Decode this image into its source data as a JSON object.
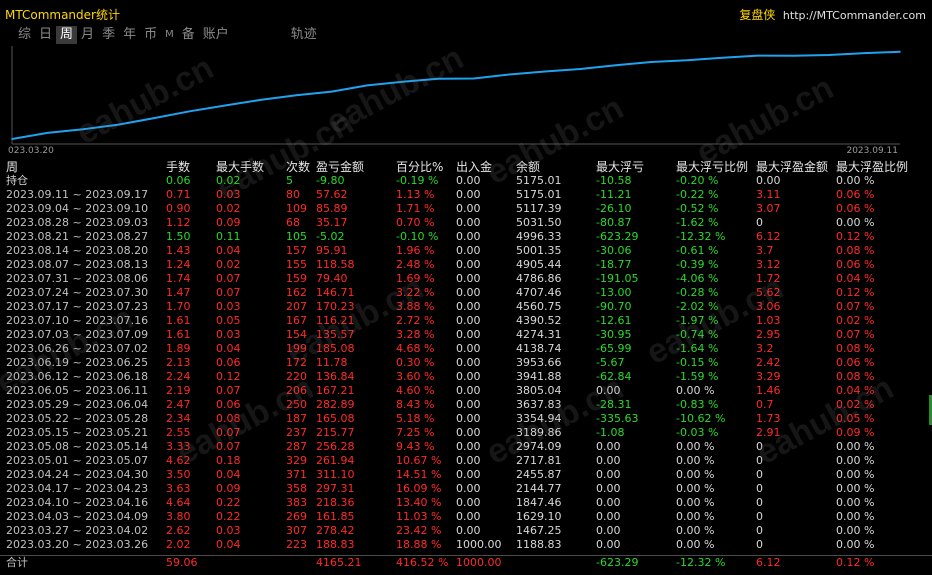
{
  "window": {
    "title": "MTCommander统计",
    "brand_name": "复盘侠",
    "brand_url": "http://MTCommander.com"
  },
  "tabs": [
    {
      "label": "综",
      "active": false
    },
    {
      "label": "日",
      "active": false
    },
    {
      "label": "周",
      "active": true
    },
    {
      "label": "月",
      "active": false
    },
    {
      "label": "季",
      "active": false
    },
    {
      "label": "年",
      "active": false
    },
    {
      "label": "币",
      "active": false
    },
    {
      "label": "M",
      "active": false
    },
    {
      "label": "备",
      "active": false
    },
    {
      "label": "账户",
      "active": false
    },
    {
      "label": "轨迹",
      "active": false
    }
  ],
  "chart_data": {
    "type": "line",
    "x_start_label": "023.03.20",
    "x_end_label": "2023.09.11",
    "series": [
      {
        "color": "#1fa3f0",
        "values": [
          1188.83,
          1467.25,
          1629.1,
          1847.46,
          2144.77,
          2455.87,
          2717.81,
          2974.09,
          3189.86,
          3354.94,
          3637.83,
          3805.04,
          3941.88,
          3953.66,
          4138.74,
          4274.31,
          4390.52,
          4560.75,
          4707.46,
          4786.86,
          4905.44,
          5001.35,
          4996.33,
          5031.5,
          5117.39,
          5175.01
        ]
      }
    ]
  },
  "table": {
    "headers": [
      "周",
      "手数",
      "最大手数",
      "次数",
      "盈亏金额",
      "百分比%",
      "出入金",
      "余额",
      "最大浮亏",
      "最大浮亏比例",
      "最大浮盈金额",
      "最大浮盈比例"
    ],
    "holding": {
      "label": "持仓",
      "lots": "0.06",
      "max_lots": "0.02",
      "count": "5",
      "pnl": "-9.80",
      "pct": "-0.19 %",
      "io": "0.00",
      "balance": "5175.01",
      "max_loss": "-10.58",
      "max_loss_pct": "-0.20 %",
      "max_gain": "0.00",
      "max_gain_pct": "0.00 %"
    },
    "rows": [
      {
        "week": "2023.09.11 ~ 2023.09.17",
        "lots": "0.71",
        "max_lots": "0.03",
        "count": "80",
        "pnl": "57.62",
        "pct": "1.13 %",
        "io": "0.00",
        "balance": "5175.01",
        "max_loss": "-11.21",
        "max_loss_pct": "-0.22 %",
        "max_gain": "3.11",
        "max_gain_pct": "0.06 %",
        "tone": "red"
      },
      {
        "week": "2023.09.04 ~ 2023.09.10",
        "lots": "0.90",
        "max_lots": "0.02",
        "count": "109",
        "pnl": "85.89",
        "pct": "1.71 %",
        "io": "0.00",
        "balance": "5117.39",
        "max_loss": "-26.10",
        "max_loss_pct": "-0.52 %",
        "max_gain": "3.07",
        "max_gain_pct": "0.06 %",
        "tone": "red"
      },
      {
        "week": "2023.08.28 ~ 2023.09.03",
        "lots": "1.12",
        "max_lots": "0.09",
        "count": "68",
        "pnl": "35.17",
        "pct": "0.70 %",
        "io": "0.00",
        "balance": "5031.50",
        "max_loss": "-80.87",
        "max_loss_pct": "-1.62 %",
        "max_gain": "0",
        "max_gain_pct": "0.00 %",
        "tone": "red"
      },
      {
        "week": "2023.08.21 ~ 2023.08.27",
        "lots": "1.50",
        "max_lots": "0.11",
        "count": "105",
        "pnl": "-5.02",
        "pct": "-0.10 %",
        "io": "0.00",
        "balance": "4996.33",
        "max_loss": "-623.29",
        "max_loss_pct": "-12.32 %",
        "max_gain": "6.12",
        "max_gain_pct": "0.12 %",
        "tone": "grn"
      },
      {
        "week": "2023.08.14 ~ 2023.08.20",
        "lots": "1.43",
        "max_lots": "0.04",
        "count": "157",
        "pnl": "95.91",
        "pct": "1.96 %",
        "io": "0.00",
        "balance": "5001.35",
        "max_loss": "-30.06",
        "max_loss_pct": "-0.61 %",
        "max_gain": "3.7",
        "max_gain_pct": "0.08 %",
        "tone": "red"
      },
      {
        "week": "2023.08.07 ~ 2023.08.13",
        "lots": "1.24",
        "max_lots": "0.02",
        "count": "155",
        "pnl": "118.58",
        "pct": "2.48 %",
        "io": "0.00",
        "balance": "4905.44",
        "max_loss": "-18.77",
        "max_loss_pct": "-0.39 %",
        "max_gain": "3.12",
        "max_gain_pct": "0.06 %",
        "tone": "red"
      },
      {
        "week": "2023.07.31 ~ 2023.08.06",
        "lots": "1.74",
        "max_lots": "0.07",
        "count": "159",
        "pnl": "79.40",
        "pct": "1.69 %",
        "io": "0.00",
        "balance": "4786.86",
        "max_loss": "-191.05",
        "max_loss_pct": "-4.06 %",
        "max_gain": "1.72",
        "max_gain_pct": "0.04 %",
        "tone": "red"
      },
      {
        "week": "2023.07.24 ~ 2023.07.30",
        "lots": "1.47",
        "max_lots": "0.07",
        "count": "162",
        "pnl": "146.71",
        "pct": "3.22 %",
        "io": "0.00",
        "balance": "4707.46",
        "max_loss": "-13.00",
        "max_loss_pct": "-0.28 %",
        "max_gain": "5.62",
        "max_gain_pct": "0.12 %",
        "tone": "red"
      },
      {
        "week": "2023.07.17 ~ 2023.07.23",
        "lots": "1.70",
        "max_lots": "0.03",
        "count": "207",
        "pnl": "170.23",
        "pct": "3.88 %",
        "io": "0.00",
        "balance": "4560.75",
        "max_loss": "-90.70",
        "max_loss_pct": "-2.02 %",
        "max_gain": "3.06",
        "max_gain_pct": "0.07 %",
        "tone": "red"
      },
      {
        "week": "2023.07.10 ~ 2023.07.16",
        "lots": "1.61",
        "max_lots": "0.05",
        "count": "167",
        "pnl": "116.21",
        "pct": "2.72 %",
        "io": "0.00",
        "balance": "4390.52",
        "max_loss": "-12.61",
        "max_loss_pct": "-1.97 %",
        "max_gain": "1.03",
        "max_gain_pct": "0.02 %",
        "tone": "red"
      },
      {
        "week": "2023.07.03 ~ 2023.07.09",
        "lots": "1.61",
        "max_lots": "0.03",
        "count": "154",
        "pnl": "135.57",
        "pct": "3.28 %",
        "io": "0.00",
        "balance": "4274.31",
        "max_loss": "-30.95",
        "max_loss_pct": "-0.74 %",
        "max_gain": "2.95",
        "max_gain_pct": "0.07 %",
        "tone": "red"
      },
      {
        "week": "2023.06.26 ~ 2023.07.02",
        "lots": "1.89",
        "max_lots": "0.04",
        "count": "199",
        "pnl": "185.08",
        "pct": "4.68 %",
        "io": "0.00",
        "balance": "4138.74",
        "max_loss": "-65.99",
        "max_loss_pct": "-1.64 %",
        "max_gain": "3.2",
        "max_gain_pct": "0.08 %",
        "tone": "red"
      },
      {
        "week": "2023.06.19 ~ 2023.06.25",
        "lots": "2.13",
        "max_lots": "0.06",
        "count": "172",
        "pnl": "11.78",
        "pct": "0.30 %",
        "io": "0.00",
        "balance": "3953.66",
        "max_loss": "-5.67",
        "max_loss_pct": "-0.15 %",
        "max_gain": "2.42",
        "max_gain_pct": "0.06 %",
        "tone": "red"
      },
      {
        "week": "2023.06.12 ~ 2023.06.18",
        "lots": "2.24",
        "max_lots": "0.12",
        "count": "220",
        "pnl": "136.84",
        "pct": "3.60 %",
        "io": "0.00",
        "balance": "3941.88",
        "max_loss": "-62.84",
        "max_loss_pct": "-1.59 %",
        "max_gain": "3.29",
        "max_gain_pct": "0.08 %",
        "tone": "red"
      },
      {
        "week": "2023.06.05 ~ 2023.06.11",
        "lots": "2.19",
        "max_lots": "0.07",
        "count": "206",
        "pnl": "167.21",
        "pct": "4.60 %",
        "io": "0.00",
        "balance": "3805.04",
        "max_loss": "0.00",
        "max_loss_pct": "0.00 %",
        "max_gain": "1.46",
        "max_gain_pct": "0.04 %",
        "tone": "red"
      },
      {
        "week": "2023.05.29 ~ 2023.06.04",
        "lots": "2.47",
        "max_lots": "0.06",
        "count": "250",
        "pnl": "282.89",
        "pct": "8.43 %",
        "io": "0.00",
        "balance": "3637.83",
        "max_loss": "-28.31",
        "max_loss_pct": "-0.83 %",
        "max_gain": "0.7",
        "max_gain_pct": "0.02 %",
        "tone": "red"
      },
      {
        "week": "2023.05.22 ~ 2023.05.28",
        "lots": "2.34",
        "max_lots": "0.08",
        "count": "187",
        "pnl": "165.08",
        "pct": "5.18 %",
        "io": "0.00",
        "balance": "3354.94",
        "max_loss": "-335.63",
        "max_loss_pct": "-10.62 %",
        "max_gain": "1.73",
        "max_gain_pct": "0.05 %",
        "tone": "red"
      },
      {
        "week": "2023.05.15 ~ 2023.05.21",
        "lots": "2.55",
        "max_lots": "0.07",
        "count": "237",
        "pnl": "215.77",
        "pct": "7.25 %",
        "io": "0.00",
        "balance": "3189.86",
        "max_loss": "-1.08",
        "max_loss_pct": "-0.03 %",
        "max_gain": "2.91",
        "max_gain_pct": "0.09 %",
        "tone": "red"
      },
      {
        "week": "2023.05.08 ~ 2023.05.14",
        "lots": "3.33",
        "max_lots": "0.07",
        "count": "287",
        "pnl": "256.28",
        "pct": "9.43 %",
        "io": "0.00",
        "balance": "2974.09",
        "max_loss": "0.00",
        "max_loss_pct": "0.00 %",
        "max_gain": "0",
        "max_gain_pct": "0.00 %",
        "tone": "red"
      },
      {
        "week": "2023.05.01 ~ 2023.05.07",
        "lots": "4.62",
        "max_lots": "0.18",
        "count": "329",
        "pnl": "261.94",
        "pct": "10.67 %",
        "io": "0.00",
        "balance": "2717.81",
        "max_loss": "0.00",
        "max_loss_pct": "0.00 %",
        "max_gain": "0",
        "max_gain_pct": "0.00 %",
        "tone": "red"
      },
      {
        "week": "2023.04.24 ~ 2023.04.30",
        "lots": "3.50",
        "max_lots": "0.04",
        "count": "371",
        "pnl": "311.10",
        "pct": "14.51 %",
        "io": "0.00",
        "balance": "2455.87",
        "max_loss": "0.00",
        "max_loss_pct": "0.00 %",
        "max_gain": "0",
        "max_gain_pct": "0.00 %",
        "tone": "red"
      },
      {
        "week": "2023.04.17 ~ 2023.04.23",
        "lots": "3.63",
        "max_lots": "0.09",
        "count": "358",
        "pnl": "297.31",
        "pct": "16.09 %",
        "io": "0.00",
        "balance": "2144.77",
        "max_loss": "0.00",
        "max_loss_pct": "0.00 %",
        "max_gain": "0",
        "max_gain_pct": "0.00 %",
        "tone": "red"
      },
      {
        "week": "2023.04.10 ~ 2023.04.16",
        "lots": "4.64",
        "max_lots": "0.22",
        "count": "383",
        "pnl": "218.36",
        "pct": "13.40 %",
        "io": "0.00",
        "balance": "1847.46",
        "max_loss": "0.00",
        "max_loss_pct": "0.00 %",
        "max_gain": "0",
        "max_gain_pct": "0.00 %",
        "tone": "red"
      },
      {
        "week": "2023.04.03 ~ 2023.04.09",
        "lots": "3.80",
        "max_lots": "0.22",
        "count": "269",
        "pnl": "161.85",
        "pct": "11.03 %",
        "io": "0.00",
        "balance": "1629.10",
        "max_loss": "0.00",
        "max_loss_pct": "0.00 %",
        "max_gain": "0",
        "max_gain_pct": "0.00 %",
        "tone": "red"
      },
      {
        "week": "2023.03.27 ~ 2023.04.02",
        "lots": "2.62",
        "max_lots": "0.03",
        "count": "307",
        "pnl": "278.42",
        "pct": "23.42 %",
        "io": "0.00",
        "balance": "1467.25",
        "max_loss": "0.00",
        "max_loss_pct": "0.00 %",
        "max_gain": "0",
        "max_gain_pct": "0.00 %",
        "tone": "red"
      },
      {
        "week": "2023.03.20 ~ 2023.03.26",
        "lots": "2.02",
        "max_lots": "0.04",
        "count": "223",
        "pnl": "188.83",
        "pct": "18.88 %",
        "io": "1000.00",
        "balance": "1188.83",
        "max_loss": "0.00",
        "max_loss_pct": "0.00 %",
        "max_gain": "0",
        "max_gain_pct": "0.00 %",
        "tone": "red"
      }
    ],
    "total": {
      "label": "合计",
      "lots": "59.06",
      "pnl": "4165.21",
      "pct": "416.52 %",
      "io": "1000.00",
      "max_loss": "-623.29",
      "max_loss_pct": "-12.32 %",
      "max_gain": "6.12",
      "max_gain_pct": "0.12 %"
    }
  },
  "watermark": "eahub.cn",
  "colors": {
    "positive": "#ff2a2a",
    "negative": "#2bd92b",
    "line": "#1fa3f0",
    "title": "#ffd700"
  }
}
